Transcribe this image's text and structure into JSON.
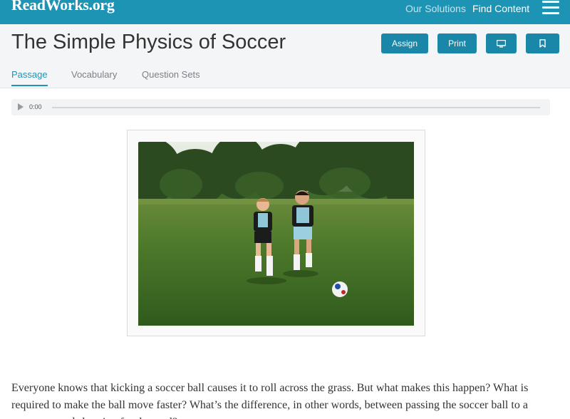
{
  "header": {
    "logo": "ReadWorks.org",
    "nav": {
      "solutions": "Our Solutions",
      "find_content": "Find Content"
    },
    "menu_icon": "hamburger-menu-icon"
  },
  "article": {
    "title": "The Simple Physics of Soccer",
    "actions": {
      "assign": "Assign",
      "print": "Print",
      "present_icon": "monitor-icon",
      "bookmark_icon": "bookmark-icon"
    },
    "tabs": [
      {
        "label": "Passage",
        "active": true
      },
      {
        "label": "Vocabulary",
        "active": false
      },
      {
        "label": "Question Sets",
        "active": false
      }
    ]
  },
  "audio": {
    "time": "0:00",
    "play_icon": "play-icon",
    "progress": 0
  },
  "image": {
    "subject": "two children kicking a soccer ball on a grass field"
  },
  "passage": {
    "text": "Everyone knows that kicking a soccer ball causes it to roll across the grass. But what makes this happen? What is required to make the ball move faster? What’s the difference, in other words, between passing the soccer ball to a teammate and shooting for the goal?"
  },
  "colors": {
    "brand": "#1e94b5",
    "button": "#1a86a8",
    "header_bg": "#f4f5f6"
  }
}
